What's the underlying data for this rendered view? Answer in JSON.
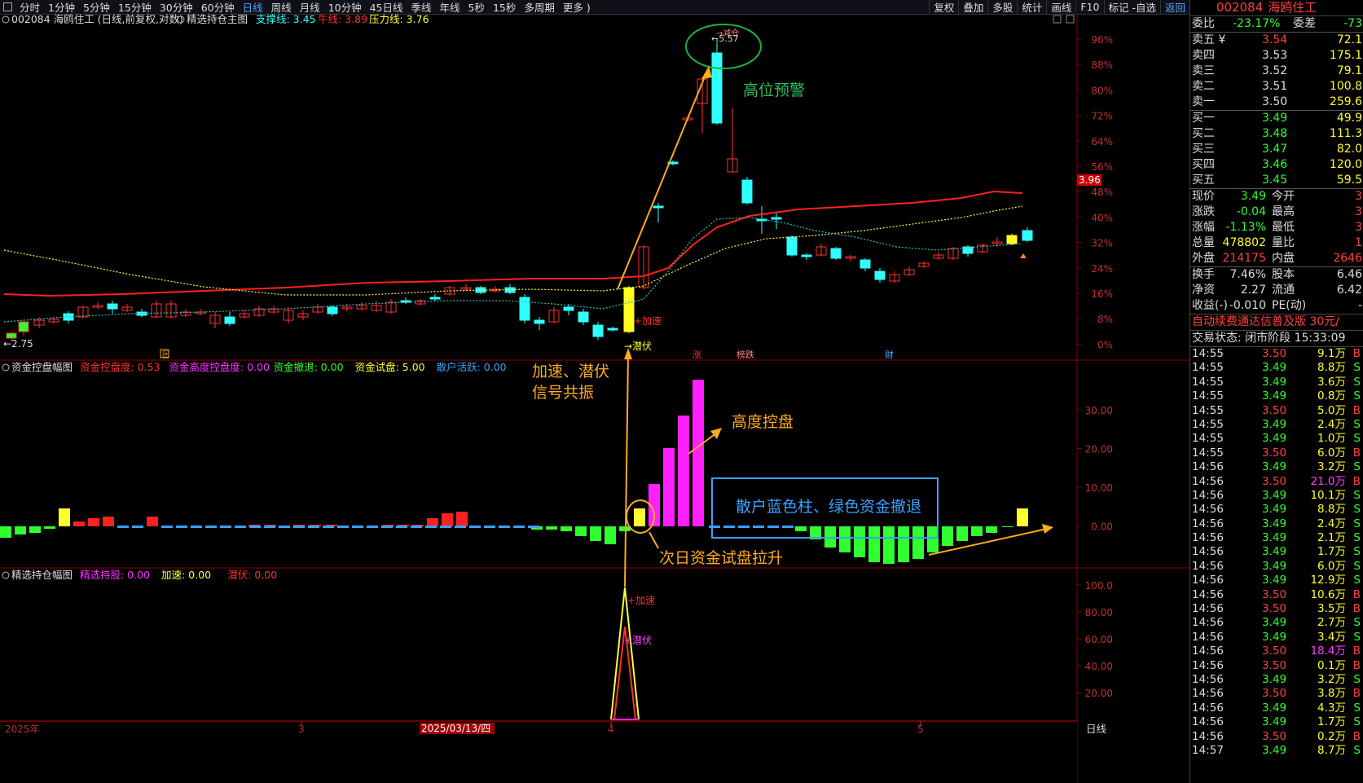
{
  "toolbar": {
    "periods": [
      "分时",
      "1分钟",
      "5分钟",
      "15分钟",
      "30分钟",
      "60分钟",
      "日线",
      "周线",
      "月线",
      "10分钟",
      "45日线",
      "季线",
      "年线",
      "5秒",
      "15秒",
      "多周期",
      "更多 )"
    ],
    "active": "日线",
    "right_items": [
      "复权",
      "叠加",
      "多股",
      "统计",
      "画线",
      "F10",
      "标记 -自选",
      "返回"
    ]
  },
  "main_chart": {
    "header_stock": "002084 海鸥住工 (日线,前复权,对数)",
    "header_indicator": "精选持仓主图",
    "support_label": "支撑线: 3.45",
    "cow_label": "牛线: 3.89",
    "pressure_label": "压力线: 3.76",
    "y_ticks": [
      "96%",
      "88%",
      "80%",
      "72%",
      "64%",
      "56%",
      "48%",
      "40%",
      "32%",
      "24%",
      "16%",
      "8%",
      "0%"
    ],
    "price_marker": "3.96",
    "low_label": "←2.75",
    "high_label": "←5.57",
    "high_signal": "→减仓",
    "signal_jiasu": "+加速",
    "signal_qianfu": "→潜伏",
    "tag_zhang": "涨",
    "tag_bangdie": "榜跌",
    "tag_cai": "财",
    "tag_hui": "回"
  },
  "annotations": {
    "high_warning": "高位预警",
    "resonance_line1": "加速、潜伏",
    "resonance_line2": "信号共振",
    "high_control": "高度控盘",
    "next_day": "次日资金试盘拉升",
    "retreat": "散户蓝色柱、绿色资金撤退"
  },
  "pane2": {
    "title": "资金控盘幅图",
    "items": [
      {
        "label": "资金控盘度: 0.53",
        "color": "#ff3030"
      },
      {
        "label": "资金高度控盘度: 0.00",
        "color": "#ff30ff"
      },
      {
        "label": "资金撤退: 0.00",
        "color": "#30ff30"
      },
      {
        "label": "资金试盘: 5.00",
        "color": "#ffff30"
      },
      {
        "label": "散户活跃: 0.00",
        "color": "#3aa0ff"
      }
    ],
    "y_ticks": [
      "30.00",
      "20.00",
      "10.00",
      "0.00"
    ]
  },
  "pane3": {
    "title": "精选持仓幅图",
    "items": [
      {
        "label": "精选持股: 0.00",
        "color": "#ff30ff"
      },
      {
        "label": "加速: 0.00",
        "color": "#ffff30"
      },
      {
        "label": "潜伏: 0.00",
        "color": "#ff3030"
      }
    ],
    "y_ticks": [
      "100.0",
      "80.00",
      "60.00",
      "40.00",
      "20.00"
    ],
    "jiasu": "+加速",
    "qianfu": "+潜伏"
  },
  "axis": {
    "labels": [
      "2025年",
      "3",
      "2025/03/13/四",
      "4",
      "5"
    ],
    "period": "日线"
  },
  "quote": {
    "code": "002084",
    "name": "海鸥住工",
    "weibi_label": "委比",
    "weibi": "-23.17%",
    "weicha_label": "委差",
    "weicha": "-73",
    "sells": [
      {
        "label": "卖五 ¥",
        "price": "3.54",
        "vol": "72.1"
      },
      {
        "label": "卖四",
        "price": "3.53",
        "vol": "175.1"
      },
      {
        "label": "卖三",
        "price": "3.52",
        "vol": "79.1"
      },
      {
        "label": "卖二",
        "price": "3.51",
        "vol": "100.8"
      },
      {
        "label": "卖一",
        "price": "3.50",
        "vol": "259.6"
      }
    ],
    "buys": [
      {
        "label": "买一",
        "price": "3.49",
        "vol": "49.9"
      },
      {
        "label": "买二",
        "price": "3.48",
        "vol": "111.3"
      },
      {
        "label": "买三",
        "price": "3.47",
        "vol": "82.0"
      },
      {
        "label": "买四",
        "price": "3.46",
        "vol": "120.0"
      },
      {
        "label": "买五",
        "price": "3.45",
        "vol": "59.5"
      }
    ],
    "stats": [
      {
        "l1": "现价",
        "v1": "3.49",
        "c1": "#30ff30",
        "l2": "今开",
        "v2": "3"
      },
      {
        "l1": "涨跌",
        "v1": "-0.04",
        "c1": "#30ff30",
        "l2": "最高",
        "v2": "3"
      },
      {
        "l1": "涨幅",
        "v1": "-1.13%",
        "c1": "#30ff30",
        "l2": "最低",
        "v2": "3"
      },
      {
        "l1": "总量",
        "v1": "478802",
        "c1": "#ffff30",
        "l2": "量比",
        "v2": "1"
      },
      {
        "l1": "外盘",
        "v1": "214175",
        "c1": "#ff4040",
        "l2": "内盘",
        "v2": "2646"
      }
    ],
    "stats2": [
      {
        "l1": "换手",
        "v1": "7.46%",
        "l2": "股本",
        "v2": "6.46"
      },
      {
        "l1": "净资",
        "v1": "2.27",
        "l2": "流通",
        "v2": "6.42"
      },
      {
        "l1": "收益(-)",
        "v1": "-0.010",
        "l2": "PE(动)",
        "v2": "-"
      }
    ],
    "notice": "自动续费通达信普及版  30元/",
    "trade_state": "交易状态: 闭市阶段 15:33:09",
    "ticks": [
      [
        "14:55",
        "3.50",
        "9.1万",
        "B"
      ],
      [
        "14:55",
        "3.49",
        "8.8万",
        "S"
      ],
      [
        "14:55",
        "3.49",
        "3.6万",
        "S"
      ],
      [
        "14:55",
        "3.49",
        "0.8万",
        "S"
      ],
      [
        "14:55",
        "3.50",
        "5.0万",
        "B"
      ],
      [
        "14:55",
        "3.49",
        "2.4万",
        "S"
      ],
      [
        "14:55",
        "3.49",
        "1.0万",
        "S"
      ],
      [
        "14:55",
        "3.50",
        "6.0万",
        "B"
      ],
      [
        "14:56",
        "3.49",
        "3.2万",
        "S"
      ],
      [
        "14:56",
        "3.50",
        "21.0万",
        "B"
      ],
      [
        "14:56",
        "3.49",
        "10.1万",
        "S"
      ],
      [
        "14:56",
        "3.49",
        "8.8万",
        "S"
      ],
      [
        "14:56",
        "3.49",
        "2.4万",
        "S"
      ],
      [
        "14:56",
        "3.49",
        "2.1万",
        "S"
      ],
      [
        "14:56",
        "3.49",
        "1.7万",
        "S"
      ],
      [
        "14:56",
        "3.49",
        "6.0万",
        "S"
      ],
      [
        "14:56",
        "3.49",
        "12.9万",
        "S"
      ],
      [
        "14:56",
        "3.50",
        "10.6万",
        "B"
      ],
      [
        "14:56",
        "3.50",
        "3.5万",
        "B"
      ],
      [
        "14:56",
        "3.49",
        "2.7万",
        "S"
      ],
      [
        "14:56",
        "3.49",
        "3.4万",
        "S"
      ],
      [
        "14:56",
        "3.50",
        "18.4万",
        "B"
      ],
      [
        "14:56",
        "3.50",
        "0.1万",
        "B"
      ],
      [
        "14:56",
        "3.49",
        "3.2万",
        "S"
      ],
      [
        "14:56",
        "3.50",
        "3.8万",
        "B"
      ],
      [
        "14:56",
        "3.49",
        "4.3万",
        "S"
      ],
      [
        "14:56",
        "3.49",
        "1.7万",
        "S"
      ],
      [
        "14:56",
        "3.50",
        "0.2万",
        "B"
      ],
      [
        "14:57",
        "3.49",
        "8.7万",
        "S"
      ]
    ]
  }
}
